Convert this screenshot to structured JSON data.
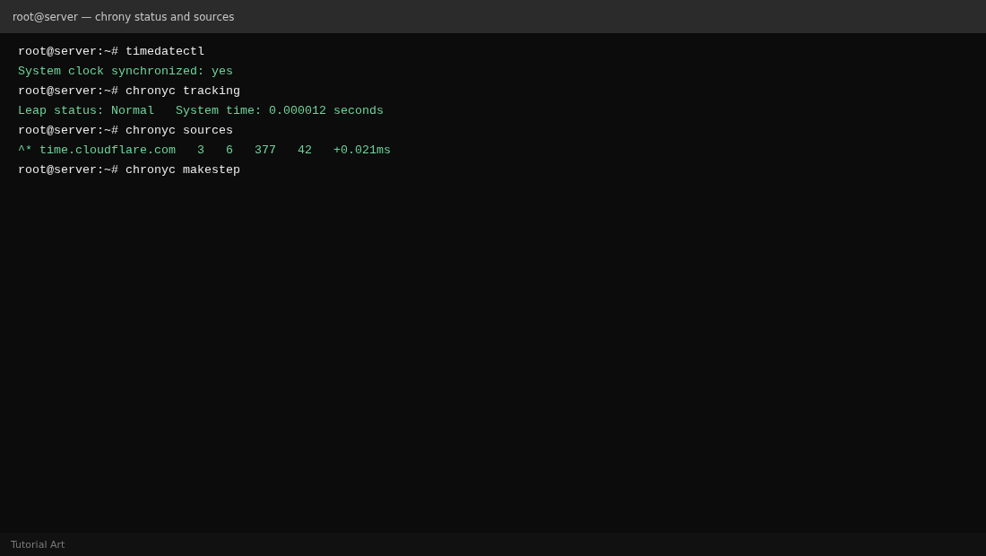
{
  "window": {
    "title": "root@server — chrony status and sources"
  },
  "terminal": {
    "lines": [
      {
        "kind": "command",
        "text": "root@server:~# timedatectl"
      },
      {
        "kind": "output",
        "text": "System clock synchronized: yes"
      },
      {
        "kind": "command",
        "text": "root@server:~# chronyc tracking"
      },
      {
        "kind": "output",
        "text": "Leap status: Normal   System time: 0.000012 seconds"
      },
      {
        "kind": "command",
        "text": "root@server:~# chronyc sources"
      },
      {
        "kind": "output",
        "text": "^* time.cloudflare.com   3   6   377   42   +0.021ms"
      },
      {
        "kind": "command",
        "text": "root@server:~# chronyc makestep"
      }
    ]
  },
  "status_bar": {
    "text": "Tutorial Art"
  }
}
